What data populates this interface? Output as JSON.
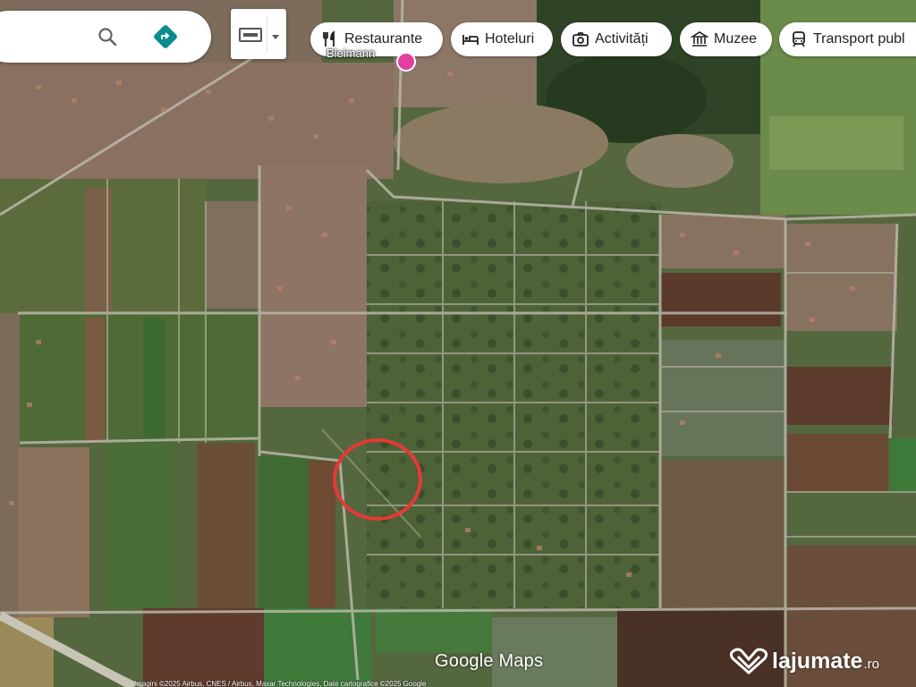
{
  "search": {
    "search_icon": "search-icon",
    "directions_icon": "directions-icon"
  },
  "layers": {
    "icon": "keyboard-icon"
  },
  "chips": [
    {
      "label": "Restaurante",
      "icon": "restaurant-icon"
    },
    {
      "label": "Hoteluri",
      "icon": "hotel-icon"
    },
    {
      "label": "Activități",
      "icon": "camera-icon"
    },
    {
      "label": "Muzee",
      "icon": "museum-icon"
    },
    {
      "label": "Transport publ",
      "icon": "train-icon"
    }
  ],
  "map": {
    "place_label": "Bleimann",
    "marker_color": "#e53935",
    "pin_color": "#e040a0"
  },
  "footer": {
    "logo": "Google Maps",
    "attribution": "Imagini ©2025 Airbus, CNES / Airbus, Maxar Technologies, Date cartografice ©2025 Google",
    "watermark": "lajumate",
    "watermark_suffix": ".ro"
  }
}
